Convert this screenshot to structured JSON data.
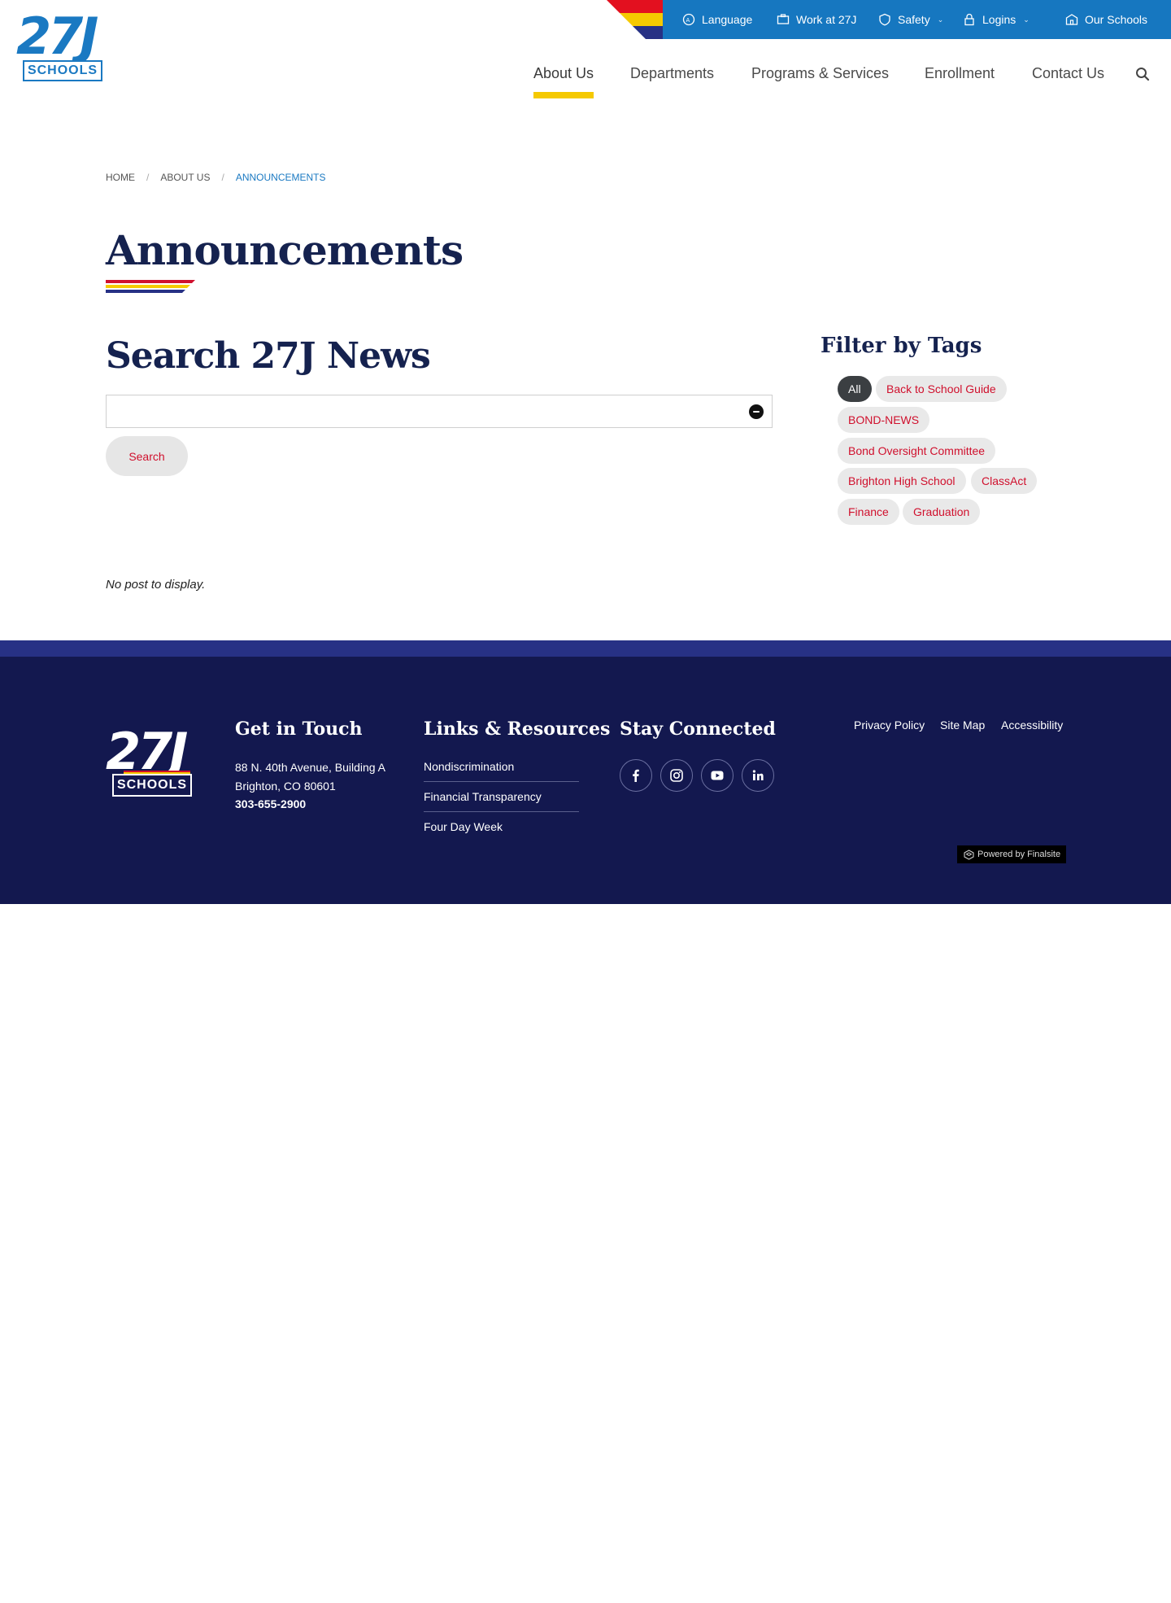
{
  "header": {
    "logo_number": "27J",
    "logo_word": "SCHOOLS",
    "utility": {
      "language": "Language",
      "work": "Work at 27J",
      "safety": "Safety",
      "logins": "Logins",
      "schools": "Our Schools"
    },
    "nav": {
      "about": "About Us",
      "departments": "Departments",
      "programs": "Programs & Services",
      "enrollment": "Enrollment",
      "contact": "Contact Us"
    }
  },
  "breadcrumb": {
    "home": "HOME",
    "about": "ABOUT US",
    "current": "ANNOUNCEMENTS"
  },
  "page": {
    "title": "Announcements",
    "search_heading": "Search 27J News",
    "search_value": "",
    "search_button": "Search",
    "no_post": "No post to display."
  },
  "tags": {
    "heading": "Filter by Tags",
    "items": [
      "All",
      "Back to School Guide",
      "BOND-NEWS",
      "Bond Oversight Committee",
      "Brighton High School",
      "ClassAct",
      "Finance",
      "Graduation"
    ]
  },
  "footer": {
    "logo_number": "27J",
    "logo_word": "SCHOOLS",
    "contact_heading": "Get in Touch",
    "address1": "88 N. 40th Avenue, Building A",
    "address2": "Brighton, CO  80601",
    "phone": "303-655-2900",
    "links_heading": "Links & Resources",
    "links": [
      "Nondiscrimination",
      "Financial Transparency",
      "Four Day Week"
    ],
    "social_heading": "Stay Connected",
    "social": [
      "facebook-icon",
      "instagram-icon",
      "youtube-icon",
      "linkedin-icon"
    ],
    "legal": {
      "privacy": "Privacy Policy",
      "sitemap": "Site Map",
      "accessibility": "Accessibility"
    },
    "powered": "Powered by Finalsite"
  },
  "colors": {
    "brand_blue": "#1677c0",
    "navy": "#13184f",
    "heading_navy": "#15224f",
    "accent_yellow": "#f5c900",
    "accent_red": "#d0102d"
  }
}
